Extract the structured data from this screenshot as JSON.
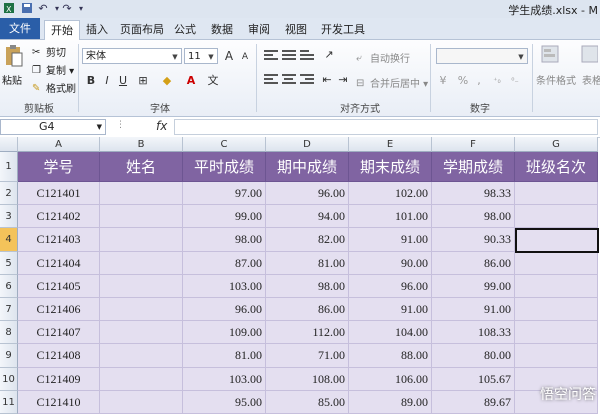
{
  "window": {
    "title": "学生成绩.xlsx - M"
  },
  "quick_access": [
    "save-icon",
    "undo-icon",
    "redo-icon",
    "customize-icon"
  ],
  "tabs": [
    "文件",
    "开始",
    "插入",
    "页面布局",
    "公式",
    "数据",
    "审阅",
    "视图",
    "开发工具"
  ],
  "clipboard": {
    "paste": "粘贴",
    "cut": "剪切",
    "copy": "复制",
    "format_painter": "格式刷",
    "label": "剪贴板"
  },
  "font": {
    "name": "宋体",
    "size": "11",
    "label": "字体",
    "bold": "B",
    "italic": "I",
    "underline": "U",
    "grow": "A",
    "shrink": "A"
  },
  "alignment": {
    "wrap": "自动换行",
    "merge": "合并后居中",
    "label": "对齐方式"
  },
  "number": {
    "label": "数字",
    "percent": "%",
    "comma": ","
  },
  "styles": {
    "conditional": "条件格式",
    "table": "表格"
  },
  "formula_bar": {
    "name_box": "G4",
    "fx": "fx",
    "value": ""
  },
  "columns": [
    "A",
    "B",
    "C",
    "D",
    "E",
    "F",
    "G"
  ],
  "rows": [
    "1",
    "2",
    "3",
    "4",
    "5",
    "6",
    "7",
    "8",
    "9",
    "10",
    "11"
  ],
  "table": {
    "headers": [
      "学号",
      "姓名",
      "平时成绩",
      "期中成绩",
      "期末成绩",
      "学期成绩",
      "班级名次"
    ],
    "data": [
      [
        "C121401",
        "",
        "97.00",
        "96.00",
        "102.00",
        "98.33",
        ""
      ],
      [
        "C121402",
        "",
        "99.00",
        "94.00",
        "101.00",
        "98.00",
        ""
      ],
      [
        "C121403",
        "",
        "98.00",
        "82.00",
        "91.00",
        "90.33",
        ""
      ],
      [
        "C121404",
        "",
        "87.00",
        "81.00",
        "90.00",
        "86.00",
        ""
      ],
      [
        "C121405",
        "",
        "103.00",
        "98.00",
        "96.00",
        "99.00",
        ""
      ],
      [
        "C121406",
        "",
        "96.00",
        "86.00",
        "91.00",
        "91.00",
        ""
      ],
      [
        "C121407",
        "",
        "109.00",
        "112.00",
        "104.00",
        "108.33",
        ""
      ],
      [
        "C121408",
        "",
        "81.00",
        "71.00",
        "88.00",
        "80.00",
        ""
      ],
      [
        "C121409",
        "",
        "103.00",
        "108.00",
        "106.00",
        "105.67",
        ""
      ],
      [
        "C121410",
        "",
        "95.00",
        "85.00",
        "89.00",
        "89.67",
        ""
      ]
    ]
  },
  "selected_cell": "G4",
  "watermark": "悟空问答",
  "colors": {
    "header_fill": "#8064a2",
    "cell_fill": "#e4dff0",
    "file_tab": "#2a5ea8"
  }
}
